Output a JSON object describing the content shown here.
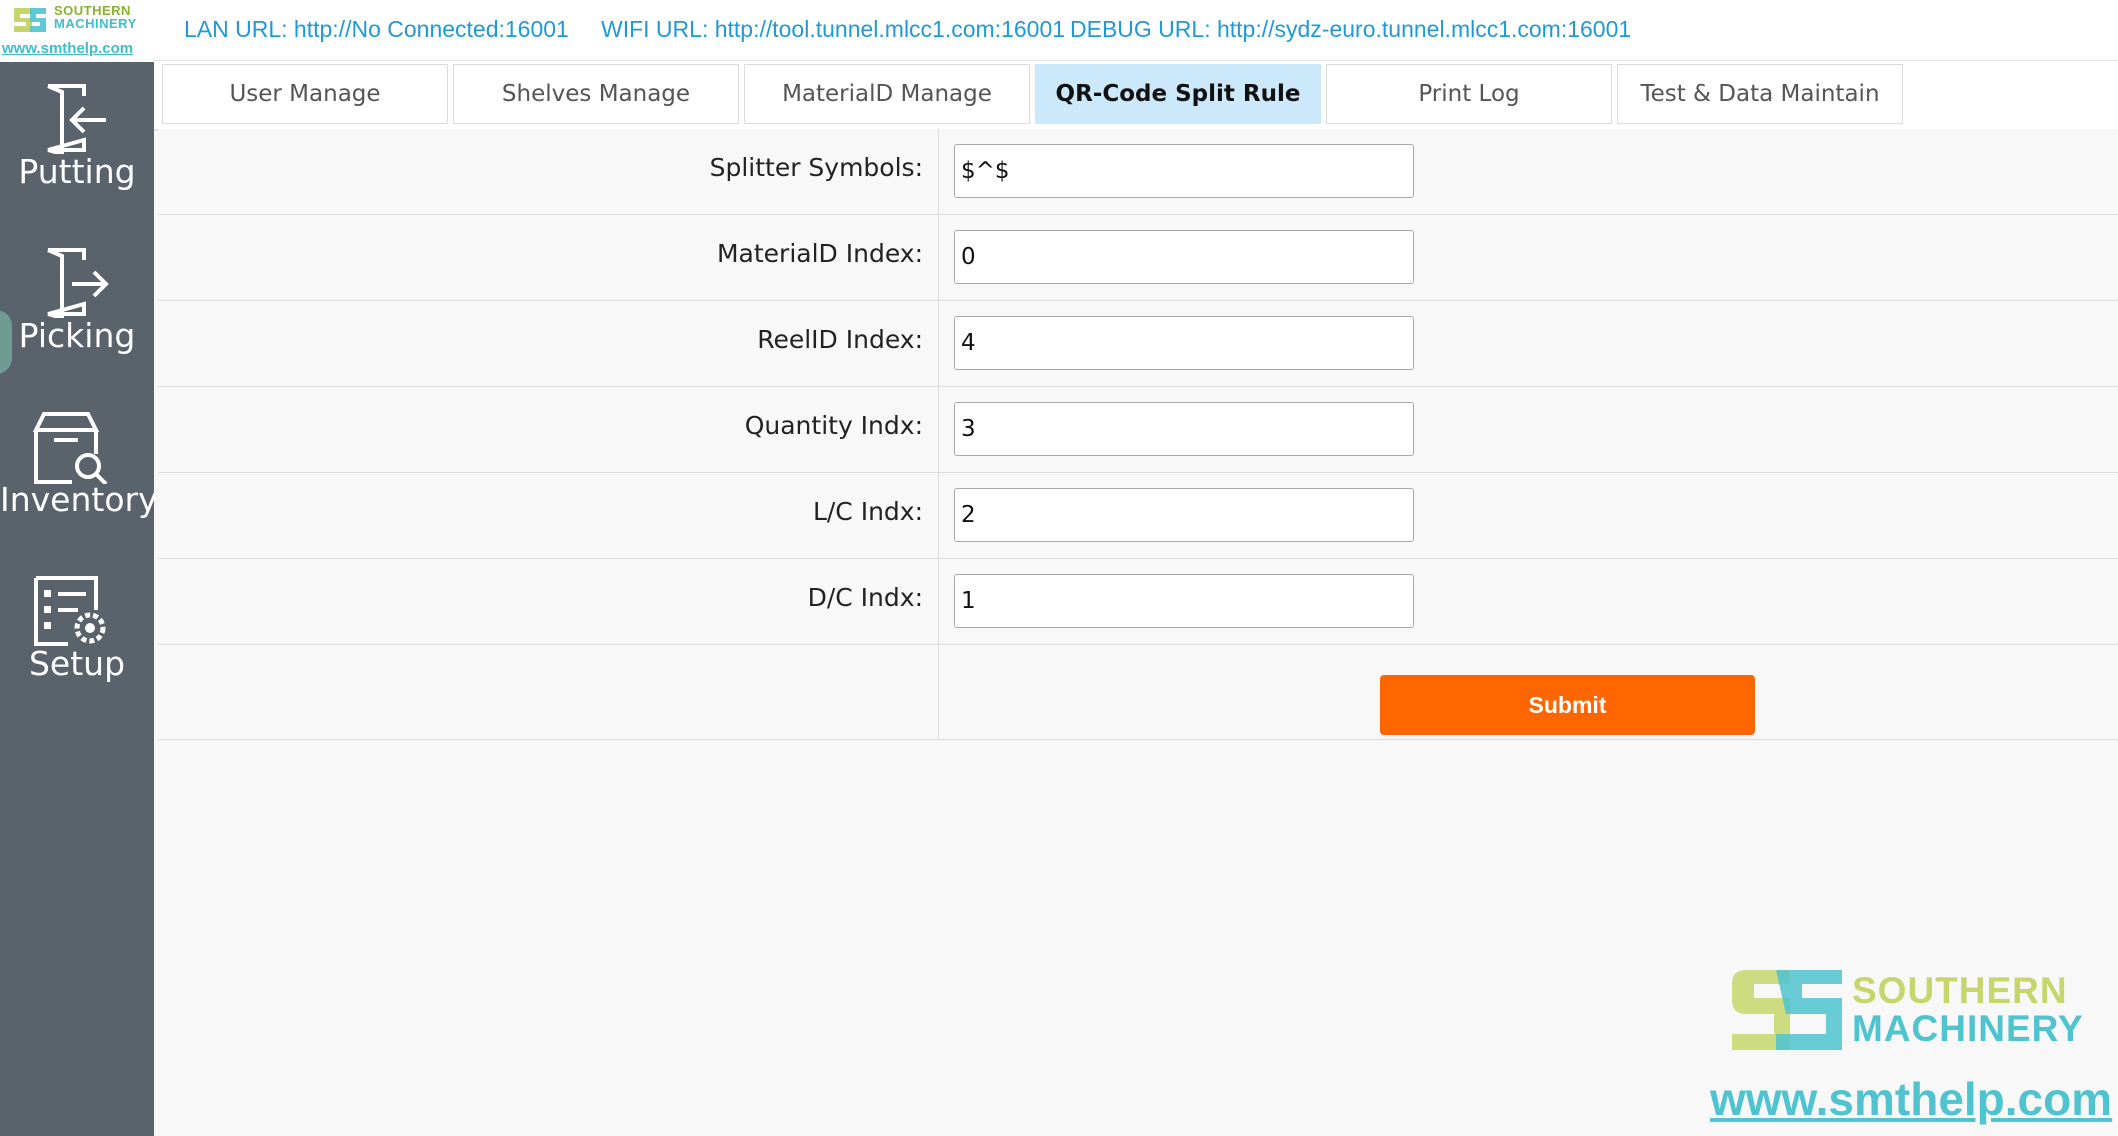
{
  "brand": {
    "line1": "SOUTHERN",
    "line2": "MACHINERY",
    "url": "www.smthelp.com"
  },
  "sidebar": {
    "items": [
      {
        "label": "Putting",
        "icon": "putting-icon"
      },
      {
        "label": "Picking",
        "icon": "picking-icon"
      },
      {
        "label": "Inventory",
        "icon": "inventory-icon"
      },
      {
        "label": "Setup",
        "icon": "setup-icon"
      }
    ]
  },
  "header": {
    "lan": "LAN URL:  http://No Connected:16001",
    "wifi": "WIFI URL:  http://tool.tunnel.mlcc1.com:16001",
    "debug": "DEBUG URL:  http://sydz-euro.tunnel.mlcc1.com:16001"
  },
  "tabs": [
    {
      "label": "User Manage"
    },
    {
      "label": "Shelves Manage"
    },
    {
      "label": "MaterialD Manage"
    },
    {
      "label": "QR-Code Split Rule",
      "active": true
    },
    {
      "label": "Print Log"
    },
    {
      "label": "Test & Data Maintain"
    }
  ],
  "form": {
    "fields": [
      {
        "label": "Splitter Symbols:",
        "value": "$^$"
      },
      {
        "label": "MaterialD Index:",
        "value": "0"
      },
      {
        "label": "ReelID Index:",
        "value": "4"
      },
      {
        "label": "Quantity Indx:",
        "value": "3"
      },
      {
        "label": "L/C Indx:",
        "value": "2"
      },
      {
        "label": "D/C Indx:",
        "value": "1"
      }
    ],
    "submit_label": "Submit"
  },
  "colors": {
    "sidebar": "#5a626b",
    "accent_link": "#1f9ad6",
    "active_tab": "#cce8fb",
    "submit": "#ff6600",
    "brand_green": "#c6d66c",
    "brand_cyan": "#4fc3d0"
  }
}
